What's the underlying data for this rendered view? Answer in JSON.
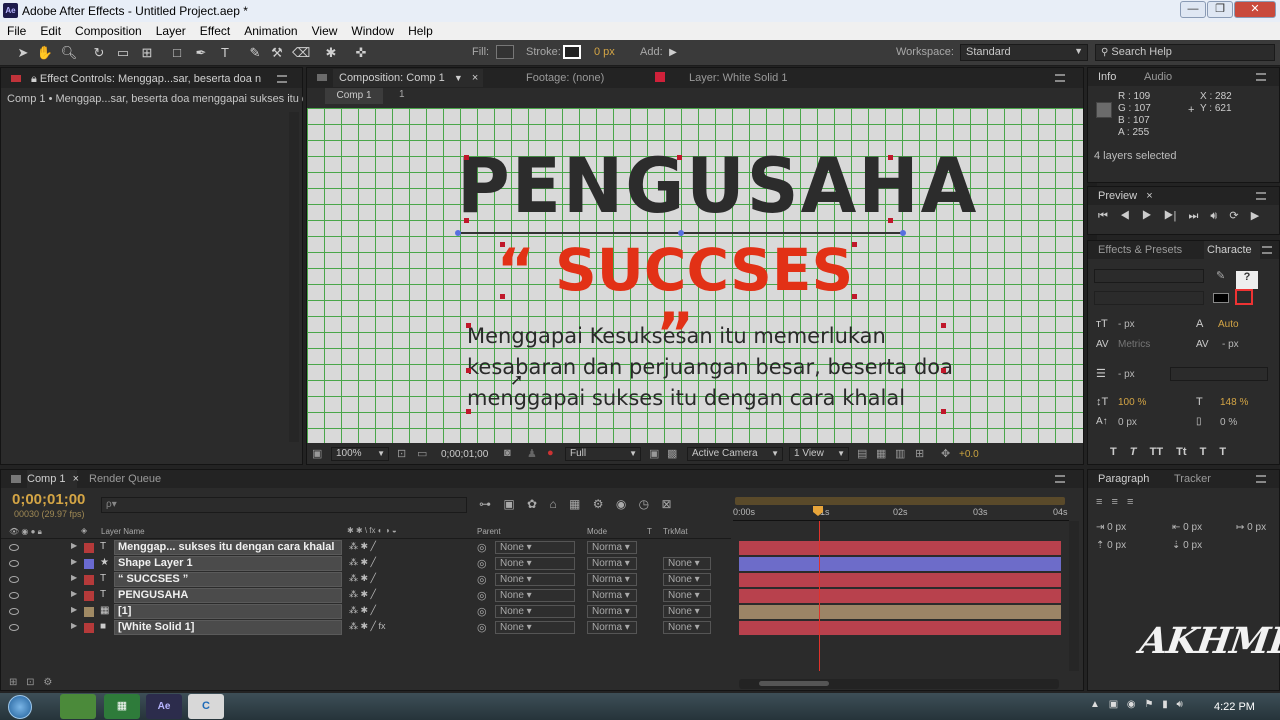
{
  "window": {
    "title": "Adobe After Effects - Untitled Project.aep *",
    "app_icon": "Ae",
    "controls": [
      "—",
      "❐",
      "✕"
    ]
  },
  "menu": [
    "File",
    "Edit",
    "Composition",
    "Layer",
    "Effect",
    "Animation",
    "View",
    "Window",
    "Help"
  ],
  "toolbar": {
    "fill_label": "Fill:",
    "stroke_label": "Stroke:",
    "stroke_px": "0 px",
    "add_label": "Add:",
    "workspace_label": "Workspace:",
    "workspace_value": "Standard",
    "search_help": "Search Help"
  },
  "project_panel": {
    "tab": "Effect Controls: Menggap...sar, beserta doa n",
    "subtitle": "Comp 1 • Menggap...sar, beserta doa menggapai sukses itu d"
  },
  "composition_panel": {
    "tab_comp": "Composition: Comp 1",
    "tab_footage": "Footage: (none)",
    "tab_layer": "Layer: White Solid 1",
    "crumb_comp": "Comp 1",
    "crumb_num": "1",
    "text_title": "PENGUSAHA",
    "text_sub": "“ SUCCSES ”",
    "body_line1": "Menggapai Kesuksesan itu memerlukan",
    "body_line2": "kesabaran dan perjuangan besar, beserta doa",
    "body_line3": "menggapai sukses itu dengan cara khalal",
    "zoom": "100%",
    "timecode": "0;00;01;00",
    "resolution": "Full",
    "camera": "Active Camera",
    "views": "1 View",
    "exposure": "+0.0"
  },
  "info_panel": {
    "tabs": [
      "Info",
      "Audio"
    ],
    "r": "R : 109",
    "g": "G : 107",
    "b": "B : 107",
    "a": "A : 255",
    "x": "X : 282",
    "y": "Y : 621",
    "status": "4 layers selected"
  },
  "preview_panel": {
    "tab": "Preview"
  },
  "effects_panel": {
    "tabs": [
      "Effects & Presets",
      "Characte"
    ]
  },
  "character_panel": {
    "px1": "- px",
    "metrics": "Metrics",
    "auto": "Auto",
    "px2": "- px",
    "px3": "- px",
    "vscale": "100 %",
    "hscale": "148 %",
    "baseline": "0 px",
    "tsume": "0 %",
    "styles": [
      "T",
      "T",
      "TT",
      "Tt",
      "T",
      "T"
    ]
  },
  "paragraph_panel": {
    "tabs": [
      "Paragraph",
      "Tracker"
    ],
    "indent1": "0 px",
    "indent2": "0 px",
    "indent3": "0 px",
    "indent4": "0 px",
    "indent5": "0 px"
  },
  "timeline": {
    "tab_comp": "Comp 1",
    "tab_render": "Render Queue",
    "timecode": "0;00;01;00",
    "frames": "00030 (29.97 fps)",
    "search_placeholder": "ρ▾",
    "col_layer": "Layer Name",
    "col_parent": "Parent",
    "col_mode": "Mode",
    "col_t": "T",
    "col_trkmat": "TrkMat",
    "ruler": [
      "0:00s",
      "01s",
      "02s",
      "03s",
      "04s"
    ],
    "layers": [
      {
        "num": "1",
        "type": "T",
        "name": "Menggap... sukses itu dengan cara khalal",
        "parent": "None",
        "mode": "Norma",
        "trkmat": "",
        "label_color": "#b53a3a",
        "bar_color": "#b8414d"
      },
      {
        "num": "2",
        "type": "★",
        "name": "Shape Layer 1",
        "parent": "None",
        "mode": "Norma",
        "trkmat": "None",
        "label_color": "#6a6ad0",
        "bar_color": "#6d6cc9"
      },
      {
        "num": "3",
        "type": "T",
        "name": "“ SUCCSES ”",
        "parent": "None",
        "mode": "Norma",
        "trkmat": "None",
        "label_color": "#b53a3a",
        "bar_color": "#b8414d"
      },
      {
        "num": "4",
        "type": "T",
        "name": "PENGUSAHA",
        "parent": "None",
        "mode": "Norma",
        "trkmat": "None",
        "label_color": "#b53a3a",
        "bar_color": "#b8414d"
      },
      {
        "num": "5",
        "type": "▦",
        "name": "[1]",
        "parent": "None",
        "mode": "Norma",
        "trkmat": "None",
        "label_color": "#a08a64",
        "bar_color": "#9c8466"
      },
      {
        "num": "6",
        "type": "■",
        "name": "[White Solid 1]",
        "parent": "None",
        "mode": "Norma",
        "trkmat": "None",
        "label_color": "#b53a3a",
        "bar_color": "#b8414d"
      }
    ]
  },
  "watermark": "AKHMED",
  "taskbar": {
    "clock": "4:22 PM"
  }
}
